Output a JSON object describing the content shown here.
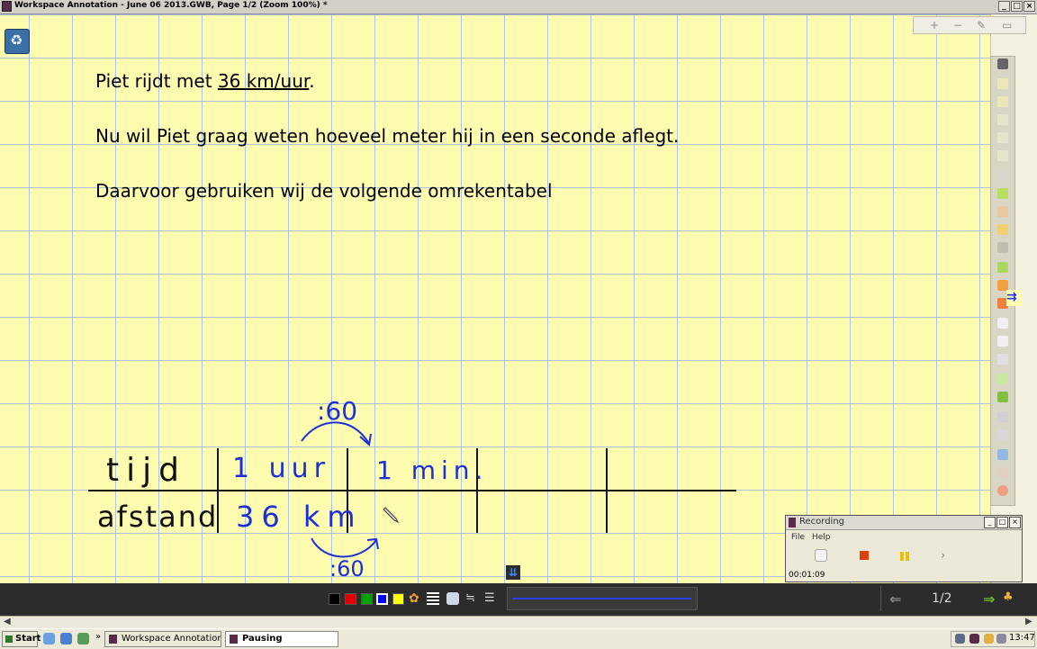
{
  "window": {
    "title": "Workspace Annotation - June 06 2013.GWB, Page 1/2  (Zoom 100%) *"
  },
  "slide": {
    "line1_pre": "Piet rijdt met ",
    "line1_underlined": "36 km/uur",
    "line1_post": ".",
    "line2": "Nu wil Piet graag weten hoeveel meter hij in een seconde aflegt.",
    "line3": "Daarvoor gebruiken wij de volgende omrekentabel"
  },
  "handwriting": {
    "row1_label": "tijd",
    "row2_label": "afstand",
    "cell_uur": "1 uur",
    "cell_km": "36 km",
    "cell_min": "1 min.",
    "arrow_top": ":60",
    "arrow_bottom": ":60",
    "ink_black": "#000000",
    "ink_blue": "#1a30d8"
  },
  "toolbar": {
    "colors": [
      "#000000",
      "#e00000",
      "#00a000",
      "#0000ff",
      "#ffff00"
    ],
    "page_indicator": "1/2"
  },
  "recording": {
    "title": "Recording",
    "menu": [
      "File",
      "Help"
    ],
    "time": "00:01:09"
  },
  "taskbar": {
    "start": "Start",
    "tasks": [
      "Workspace Annotation - ...",
      "Pausing"
    ],
    "clock": "13:47"
  }
}
